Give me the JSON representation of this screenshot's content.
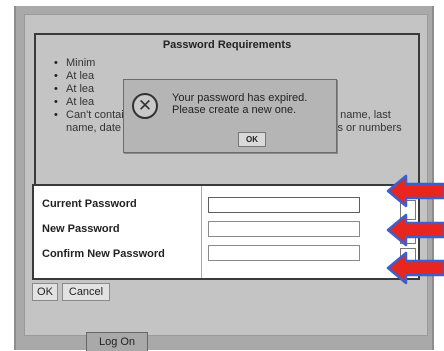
{
  "requirements": {
    "title": "Password Requirements",
    "items": [
      "Minim",
      "At lea",
      "At lea",
      "At lea",
      "Can't contain 'password', login name, first name, middle name, last name, date of birth, personal id, or only sequential letters or numbers"
    ]
  },
  "alert": {
    "icon": "error-icon",
    "line1": "Your password has expired.",
    "line2": "Please create a new one.",
    "ok_label": "OK"
  },
  "form": {
    "current_password_label": "Current Password",
    "new_password_label": "New Password",
    "confirm_password_label": "Confirm New Password",
    "current_password_value": "",
    "new_password_value": "",
    "confirm_password_value": ""
  },
  "buttons": {
    "ok_label": "OK",
    "cancel_label": "Cancel",
    "logon_label": "Log On"
  },
  "annotation_arrows": {
    "count": 3,
    "fill_color": "#e8251e",
    "outline_color": "#3a5fcf"
  }
}
